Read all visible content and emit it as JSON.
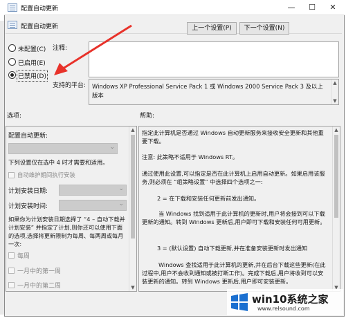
{
  "window": {
    "title": "配置自动更新",
    "controls": [
      "—",
      "☐",
      "✕"
    ]
  },
  "header": {
    "policy_name": "配置自动更新"
  },
  "nav": {
    "prev_label": "上一个设置(P)",
    "next_label": "下一个设置(N)"
  },
  "state": {
    "options": [
      {
        "label": "未配置(C)",
        "checked": false
      },
      {
        "label": "已启用(E)",
        "checked": false
      },
      {
        "label": "已禁用(D)",
        "checked": true
      }
    ]
  },
  "comment": {
    "label": "注释:",
    "value": ""
  },
  "supported": {
    "label": "支持的平台:",
    "value": "Windows XP Professional Service Pack 1 或 Windows 2000 Service Pack 3 及以上版本"
  },
  "options_section": {
    "label": "选项:",
    "configure_label": "配置自动更新:",
    "install_idle_note": "下列设置仅在选中 4 时才需要和适用。",
    "maintenance_checkbox": "自动维护期间执行安装",
    "scheduled_day_label": "计划安装日期:",
    "scheduled_time_label": "计划安装时间:",
    "schedule_note": "如果你为计划安装日期选择了 “4 – 自动下载并计划安装” 并指定了计划,则你还可以使用下面的选项,选择将更新限制为每周、每两周或每月一次:",
    "week_options": [
      "每周",
      "一月中的第一周",
      "一月中的第二周"
    ]
  },
  "help_section": {
    "label": "帮助:",
    "paragraphs": [
      "指定此计算机是否通过 Windows 自动更新服务来接收安全更新和其他重要下载。",
      "注意: 此策略不适用于 Windows RT。",
      "通过使用此设置,可以指定是否在此计算机上启用自动更新。如果启用该服务,则必须在 “组策略设置” 中选择四个选项之一:",
      "2 = 在下载和安装任何更新前发出通知。",
      "当 Windows 找到适用于此计算机的更新时,用户将会接到可以下载更新的通知。转到 Windows 更新后,用户即可下载和安装任何可用更新。",
      "3 = (默认设置) 自动下载更新,并在准备安装更新时发出通知",
      "Windows 查找适用于此计算机的更新,并在后台下载这些更新(在此过程中,用户不会收到通知或被打断工作)。完成下载后,用户将收到可以安装更新的通知。转到 Windows 更新后,用户即可安装更新。"
    ]
  },
  "watermark": {
    "brand": "win10系统之家",
    "url": "www.relsound.com"
  },
  "colors": {
    "annotation_arrow": "#e8322a",
    "disabled_control": "#cccccc"
  }
}
